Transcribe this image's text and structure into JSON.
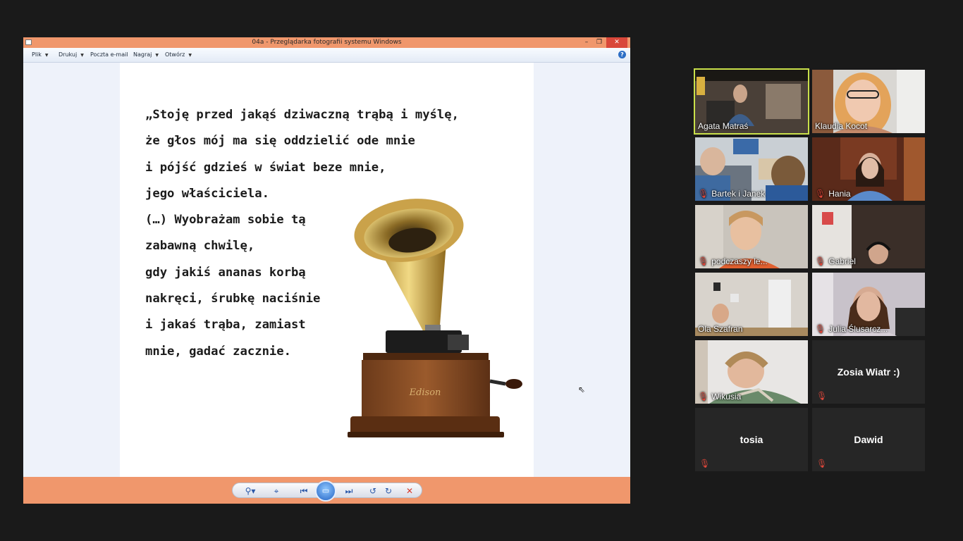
{
  "window": {
    "title": "04a - Przeglądarka fotografii systemu Windows",
    "controls": {
      "minimize": "–",
      "maximize": "❐",
      "close": "✕"
    }
  },
  "menu": [
    {
      "label": "Plik",
      "has_caret": true
    },
    {
      "label": "Drukuj",
      "has_caret": true
    },
    {
      "label": "Poczta e-mail",
      "has_caret": false
    },
    {
      "label": "Nagraj",
      "has_caret": true
    },
    {
      "label": "Otwórz",
      "has_caret": true
    }
  ],
  "help_label": "?",
  "slide": {
    "lines": [
      "„Stoję przed jakąś dziwaczną trąbą i myślę,",
      "że głos mój ma się oddzielić ode mnie",
      "i pójść gdzieś w świat beze mnie,",
      "jego właściciela.",
      "(…) Wyobrażam sobie tą",
      "zabawną chwilę,",
      "gdy jakiś ananas korbą",
      "nakręci, śrubkę naciśnie",
      "i jakaś trąba, zamiast",
      "mnie, gadać zacznie."
    ],
    "image_logo": "Edison"
  },
  "viewer_controls": {
    "zoom": "⚲▾",
    "fit": "⌖",
    "prev": "⏮",
    "slideshow": "▭",
    "next": "⏭",
    "rotate_left": "↺",
    "rotate_right": "↻",
    "delete": "✕"
  },
  "participants": [
    {
      "name": "Agata Matraś",
      "muted": false,
      "video": true,
      "active_speaker": true
    },
    {
      "name": "Klaudia Kocot",
      "muted": false,
      "video": true,
      "active_speaker": false
    },
    {
      "name": "Bartek i Janek",
      "muted": true,
      "video": true,
      "active_speaker": false
    },
    {
      "name": "Hania",
      "muted": true,
      "video": true,
      "active_speaker": false
    },
    {
      "name": "podczaszy le...",
      "muted": true,
      "video": true,
      "active_speaker": false
    },
    {
      "name": "Gabriel",
      "muted": true,
      "video": true,
      "active_speaker": false
    },
    {
      "name": "Ola Szafran",
      "muted": false,
      "video": true,
      "active_speaker": false
    },
    {
      "name": "Julia Ślusarcz...",
      "muted": true,
      "video": true,
      "active_speaker": false
    },
    {
      "name": "Wikusia",
      "muted": true,
      "video": true,
      "active_speaker": false
    },
    {
      "name": "Zosia Wiatr :)",
      "muted": true,
      "video": false,
      "active_speaker": false
    },
    {
      "name": "tosia",
      "muted": true,
      "video": false,
      "active_speaker": false
    },
    {
      "name": "Dawid",
      "muted": true,
      "video": false,
      "active_speaker": false
    }
  ],
  "colors": {
    "titlebar": "#f0976c",
    "active_speaker_border": "#c9e04a",
    "muted_icon": "#e0473a",
    "tile_off": "#262626"
  },
  "icons": {
    "muted": "mic-muted-icon",
    "cursor": "cursor-icon"
  }
}
